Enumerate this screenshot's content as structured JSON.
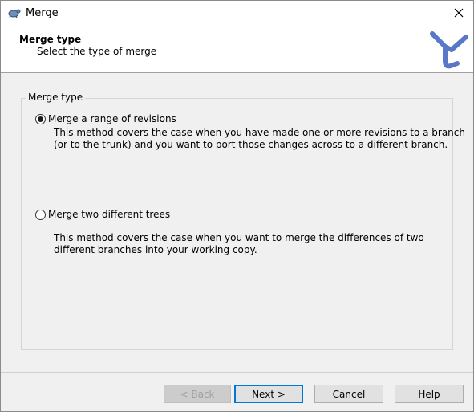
{
  "window": {
    "title": "Merge"
  },
  "header": {
    "title": "Merge type",
    "subtitle": "Select the type of merge"
  },
  "group": {
    "label": "Merge type"
  },
  "options": [
    {
      "label": "Merge a range of revisions",
      "selected": true,
      "description_lines": [
        "This method covers the case when you have made one or more revisions to a branch",
        "(or to the trunk) and you want to port those changes across to a different branch."
      ]
    },
    {
      "label": "Merge two different trees",
      "selected": false,
      "description_lines": [
        "This method covers the case when you want to merge the differences of two",
        "different branches into your working copy."
      ]
    }
  ],
  "buttons": {
    "back": "< Back",
    "next": "Next >",
    "cancel": "Cancel",
    "help": "Help"
  },
  "colors": {
    "accent": "#0078d7",
    "logo": "#5a78c8"
  }
}
